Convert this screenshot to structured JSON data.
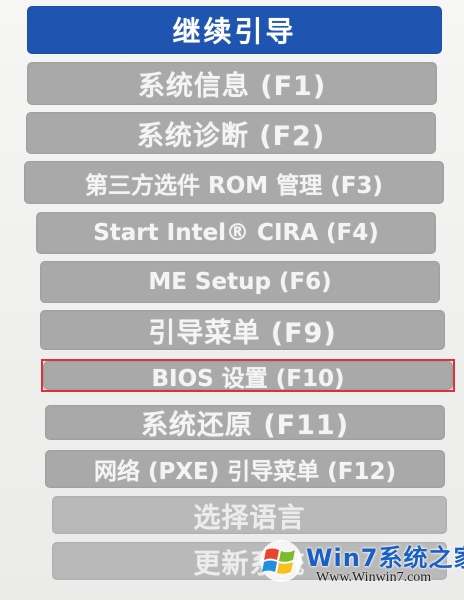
{
  "menu": {
    "items": [
      {
        "label": "继续引导"
      },
      {
        "label": "系统信息 (F1)"
      },
      {
        "label": "系统诊断 (F2)"
      },
      {
        "label": "第三方选件 ROM 管理 (F3)"
      },
      {
        "label": "Start Intel® CIRA (F4)"
      },
      {
        "label": "ME Setup (F6)"
      },
      {
        "label": "引导菜单 (F9)"
      },
      {
        "label": "BIOS 设置 (F10)"
      },
      {
        "label": "系统还原 (F11)"
      },
      {
        "label": "网络 (PXE) 引导菜单 (F12)"
      },
      {
        "label": "选择语言"
      },
      {
        "label": "更新系统"
      }
    ],
    "selected_index": 0,
    "highlighted_label": "BIOS 设置 (F10)"
  },
  "watermark": {
    "brand": "Win7系统之家",
    "url": "Www.Winwin7.com",
    "logo_icon": "windows-flag-icon"
  },
  "colors": {
    "selected": "#1f55b0",
    "item": "#a9a9a9",
    "highlight_border": "#e0303a",
    "text": "#f4f4f4"
  }
}
